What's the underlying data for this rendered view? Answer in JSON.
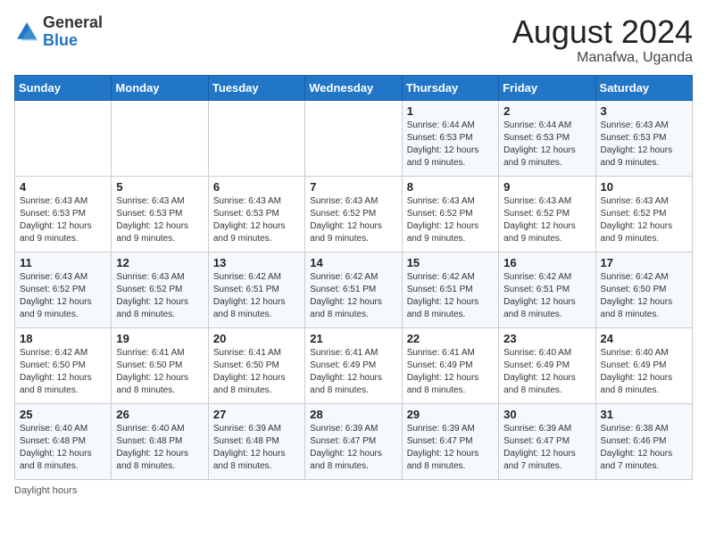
{
  "header": {
    "logo": {
      "general": "General",
      "blue": "Blue"
    },
    "title": "August 2024",
    "location": "Manafwa, Uganda"
  },
  "days_of_week": [
    "Sunday",
    "Monday",
    "Tuesday",
    "Wednesday",
    "Thursday",
    "Friday",
    "Saturday"
  ],
  "weeks": [
    [
      {
        "day": "",
        "info": ""
      },
      {
        "day": "",
        "info": ""
      },
      {
        "day": "",
        "info": ""
      },
      {
        "day": "",
        "info": ""
      },
      {
        "day": "1",
        "info": "Sunrise: 6:44 AM\nSunset: 6:53 PM\nDaylight: 12 hours and 9 minutes."
      },
      {
        "day": "2",
        "info": "Sunrise: 6:44 AM\nSunset: 6:53 PM\nDaylight: 12 hours and 9 minutes."
      },
      {
        "day": "3",
        "info": "Sunrise: 6:43 AM\nSunset: 6:53 PM\nDaylight: 12 hours and 9 minutes."
      }
    ],
    [
      {
        "day": "4",
        "info": "Sunrise: 6:43 AM\nSunset: 6:53 PM\nDaylight: 12 hours and 9 minutes."
      },
      {
        "day": "5",
        "info": "Sunrise: 6:43 AM\nSunset: 6:53 PM\nDaylight: 12 hours and 9 minutes."
      },
      {
        "day": "6",
        "info": "Sunrise: 6:43 AM\nSunset: 6:53 PM\nDaylight: 12 hours and 9 minutes."
      },
      {
        "day": "7",
        "info": "Sunrise: 6:43 AM\nSunset: 6:52 PM\nDaylight: 12 hours and 9 minutes."
      },
      {
        "day": "8",
        "info": "Sunrise: 6:43 AM\nSunset: 6:52 PM\nDaylight: 12 hours and 9 minutes."
      },
      {
        "day": "9",
        "info": "Sunrise: 6:43 AM\nSunset: 6:52 PM\nDaylight: 12 hours and 9 minutes."
      },
      {
        "day": "10",
        "info": "Sunrise: 6:43 AM\nSunset: 6:52 PM\nDaylight: 12 hours and 9 minutes."
      }
    ],
    [
      {
        "day": "11",
        "info": "Sunrise: 6:43 AM\nSunset: 6:52 PM\nDaylight: 12 hours and 9 minutes."
      },
      {
        "day": "12",
        "info": "Sunrise: 6:43 AM\nSunset: 6:52 PM\nDaylight: 12 hours and 8 minutes."
      },
      {
        "day": "13",
        "info": "Sunrise: 6:42 AM\nSunset: 6:51 PM\nDaylight: 12 hours and 8 minutes."
      },
      {
        "day": "14",
        "info": "Sunrise: 6:42 AM\nSunset: 6:51 PM\nDaylight: 12 hours and 8 minutes."
      },
      {
        "day": "15",
        "info": "Sunrise: 6:42 AM\nSunset: 6:51 PM\nDaylight: 12 hours and 8 minutes."
      },
      {
        "day": "16",
        "info": "Sunrise: 6:42 AM\nSunset: 6:51 PM\nDaylight: 12 hours and 8 minutes."
      },
      {
        "day": "17",
        "info": "Sunrise: 6:42 AM\nSunset: 6:50 PM\nDaylight: 12 hours and 8 minutes."
      }
    ],
    [
      {
        "day": "18",
        "info": "Sunrise: 6:42 AM\nSunset: 6:50 PM\nDaylight: 12 hours and 8 minutes."
      },
      {
        "day": "19",
        "info": "Sunrise: 6:41 AM\nSunset: 6:50 PM\nDaylight: 12 hours and 8 minutes."
      },
      {
        "day": "20",
        "info": "Sunrise: 6:41 AM\nSunset: 6:50 PM\nDaylight: 12 hours and 8 minutes."
      },
      {
        "day": "21",
        "info": "Sunrise: 6:41 AM\nSunset: 6:49 PM\nDaylight: 12 hours and 8 minutes."
      },
      {
        "day": "22",
        "info": "Sunrise: 6:41 AM\nSunset: 6:49 PM\nDaylight: 12 hours and 8 minutes."
      },
      {
        "day": "23",
        "info": "Sunrise: 6:40 AM\nSunset: 6:49 PM\nDaylight: 12 hours and 8 minutes."
      },
      {
        "day": "24",
        "info": "Sunrise: 6:40 AM\nSunset: 6:49 PM\nDaylight: 12 hours and 8 minutes."
      }
    ],
    [
      {
        "day": "25",
        "info": "Sunrise: 6:40 AM\nSunset: 6:48 PM\nDaylight: 12 hours and 8 minutes."
      },
      {
        "day": "26",
        "info": "Sunrise: 6:40 AM\nSunset: 6:48 PM\nDaylight: 12 hours and 8 minutes."
      },
      {
        "day": "27",
        "info": "Sunrise: 6:39 AM\nSunset: 6:48 PM\nDaylight: 12 hours and 8 minutes."
      },
      {
        "day": "28",
        "info": "Sunrise: 6:39 AM\nSunset: 6:47 PM\nDaylight: 12 hours and 8 minutes."
      },
      {
        "day": "29",
        "info": "Sunrise: 6:39 AM\nSunset: 6:47 PM\nDaylight: 12 hours and 8 minutes."
      },
      {
        "day": "30",
        "info": "Sunrise: 6:39 AM\nSunset: 6:47 PM\nDaylight: 12 hours and 7 minutes."
      },
      {
        "day": "31",
        "info": "Sunrise: 6:38 AM\nSunset: 6:46 PM\nDaylight: 12 hours and 7 minutes."
      }
    ]
  ],
  "footer": {
    "daylight_label": "Daylight hours"
  }
}
